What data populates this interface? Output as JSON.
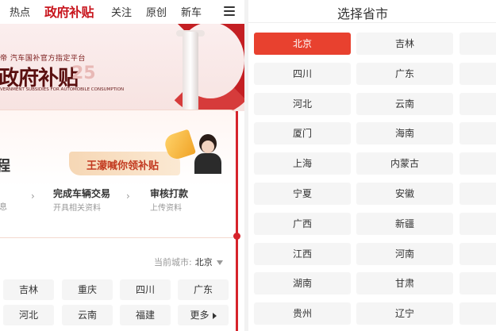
{
  "nav": {
    "items": [
      "热点",
      "关注",
      "原创",
      "新车"
    ],
    "brand": "政府补贴"
  },
  "banner": {
    "subtitle": "帝 汽车国补官方指定平台",
    "title": "政府补贴",
    "year": "25",
    "english": "VERNMENT SUBSIDIES FOR AUTOMOBILE CONSUMPTION"
  },
  "card": {
    "title_fragment": "程",
    "promo": "王濛喊你领补贴",
    "steps": [
      {
        "title": "",
        "desc": "息"
      },
      {
        "title": "完成车辆交易",
        "desc": "开具相关资料"
      },
      {
        "title": "审核打款",
        "desc": "上传资料"
      }
    ]
  },
  "city_selector": {
    "label": "当前城市:",
    "current": "北京"
  },
  "left_cities": [
    [
      "吉林",
      "重庆",
      "四川",
      "广东"
    ],
    [
      "河北",
      "云南",
      "福建",
      "更多"
    ]
  ],
  "province_picker": {
    "title": "选择省市",
    "selected": "北京",
    "rows": [
      [
        "北京",
        "吉林"
      ],
      [
        "四川",
        "广东"
      ],
      [
        "河北",
        "云南"
      ],
      [
        "厦门",
        "海南"
      ],
      [
        "上海",
        "内蒙古"
      ],
      [
        "宁夏",
        "安徽"
      ],
      [
        "广西",
        "新疆"
      ],
      [
        "江西",
        "河南"
      ],
      [
        "湖南",
        "甘肃"
      ],
      [
        "贵州",
        "辽宁"
      ]
    ]
  },
  "colors": {
    "brand_red": "#c8161e",
    "active_red": "#e8412f",
    "cell_bg": "#f5f5f5"
  }
}
